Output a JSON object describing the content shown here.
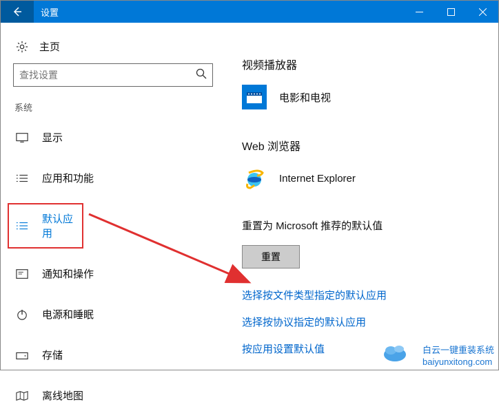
{
  "titlebar": {
    "title": "设置"
  },
  "sidebar": {
    "home": "主页",
    "search_placeholder": "查找设置",
    "category": "系统",
    "items": [
      {
        "label": "显示"
      },
      {
        "label": "应用和功能"
      },
      {
        "label": "默认应用"
      },
      {
        "label": "通知和操作"
      },
      {
        "label": "电源和睡眠"
      },
      {
        "label": "存储"
      },
      {
        "label": "离线地图"
      }
    ]
  },
  "content": {
    "video": {
      "title": "视频播放器",
      "app": "电影和电视"
    },
    "web": {
      "title": "Web 浏览器",
      "app": "Internet Explorer"
    },
    "reset": {
      "title": "重置为 Microsoft 推荐的默认值",
      "button": "重置"
    },
    "links": {
      "by_file_type": "选择按文件类型指定的默认应用",
      "by_protocol": "选择按协议指定的默认应用",
      "by_app": "按应用设置默认值"
    }
  },
  "watermark": {
    "line1": "白云一键重装系统",
    "line2": "baiyunxitong.com"
  }
}
